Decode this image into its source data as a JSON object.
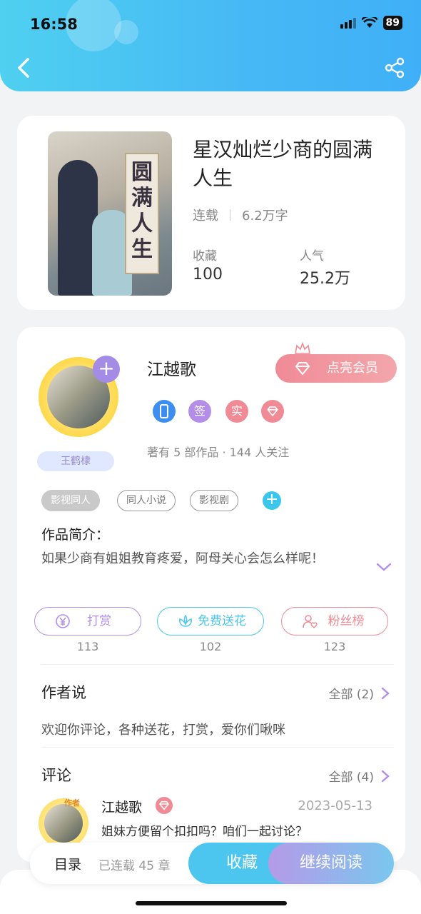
{
  "status_bar": {
    "time": "16:58",
    "battery": "89"
  },
  "book": {
    "cover_text": "圆满人生",
    "title": "星汉灿烂少商的圆满人生",
    "status": "连载",
    "word_count": "6.2万字",
    "stats": [
      {
        "label": "收藏",
        "value": "100"
      },
      {
        "label": "人气",
        "value": "25.2万"
      }
    ]
  },
  "author": {
    "name": "江越歌",
    "avatar_tag": "王鹤棣",
    "vip_button": "点亮会员",
    "badges": [
      {
        "icon": "phone-icon",
        "text": "",
        "color": "#3c8ff0"
      },
      {
        "icon": "sign-icon",
        "text": "签",
        "color": "#b38ee8"
      },
      {
        "icon": "real-icon",
        "text": "实",
        "color": "#f08b96"
      },
      {
        "icon": "gem-icon",
        "text": "",
        "color": "#f08b96"
      }
    ],
    "summary": "著有 5 部作品 · 144 人关注"
  },
  "tags": [
    "影视同人",
    "同人小说",
    "影视剧"
  ],
  "intro": {
    "title": "作品简介：",
    "text": "如果少商有姐姐教育疼爱，阿母关心会怎么样呢！"
  },
  "actions": [
    {
      "label": "打赏",
      "count": "113",
      "color": "#b38ee8",
      "icon": "yen-icon"
    },
    {
      "label": "免费送花",
      "count": "102",
      "color": "#4cc6ef",
      "icon": "flower-icon"
    },
    {
      "label": "粉丝榜",
      "count": "123",
      "color": "#f08b96",
      "icon": "fans-icon"
    }
  ],
  "author_says": {
    "title": "作者说",
    "more": "全部 (2)",
    "text": "欢迎你评论，各种送花，打赏，爱你们啾咪"
  },
  "comments": {
    "title": "评论",
    "more": "全部 (4)",
    "items": [
      {
        "name": "江越歌",
        "date": "2023-05-13",
        "text": "姐妹方便留个扣扣吗？咱们一起讨论？",
        "badge": "作者"
      }
    ]
  },
  "bottom_bar": {
    "toc_label": "目录",
    "chapters": "已连载 45 章",
    "collect": "收藏",
    "continue": "继续阅读"
  }
}
